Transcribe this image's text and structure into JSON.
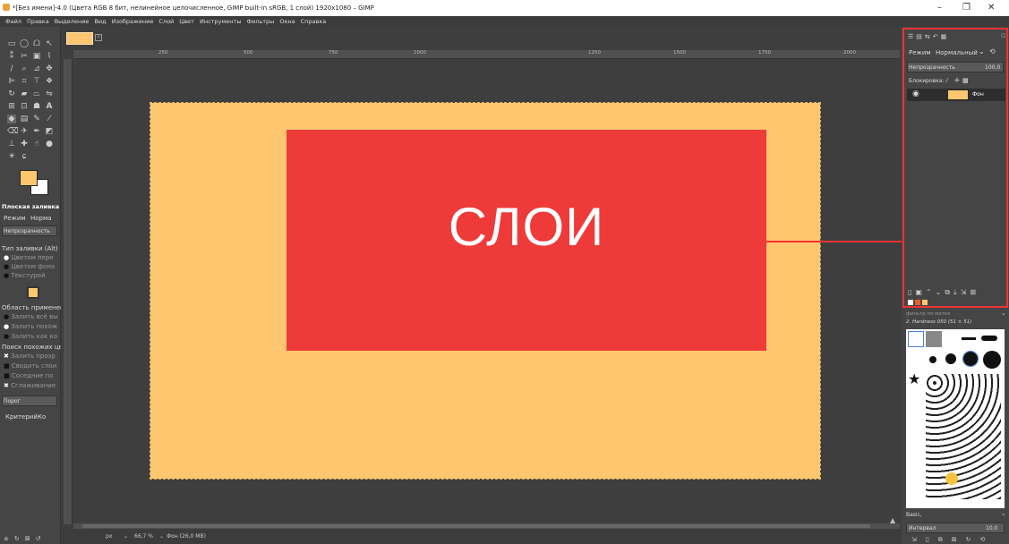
{
  "window": {
    "title": "*[Без имени]-4.0 (Цвета RGB 8 бит, нелинейное целочисленное, GIMP built-in sRGB, 1 слой) 1920x1080 – GIMP",
    "controls": [
      "–",
      "❐",
      "✕"
    ]
  },
  "menu": [
    "Файл",
    "Правка",
    "Выделение",
    "Вид",
    "Изображение",
    "Слой",
    "Цвет",
    "Инструменты",
    "Фильтры",
    "Окна",
    "Справка"
  ],
  "ruler": {
    "h_ticks": [
      "250",
      "500",
      "750",
      "1000",
      "1250",
      "1500",
      "1750",
      "2000"
    ]
  },
  "canvas": {
    "background_color": "#ffc670",
    "box_color": "#ef3a3a",
    "box_text": "СЛОИ"
  },
  "tool_options": {
    "title": "Плоская заливка",
    "mode_label": "Режим",
    "mode_value": "Норма",
    "opacity_label": "Непрозрачность",
    "fill_type_label": "Тип заливки (Alt)",
    "fill_options": [
      "Цветом пере",
      "Цветом фона",
      "Текстурой"
    ],
    "area_label": "Область применени",
    "area_options": [
      "Залить всё вы",
      "Залить похож",
      "Залить как ко"
    ],
    "similar_label": "Поиск похожих цве",
    "checks": [
      "Залить прозр",
      "Сводить слои",
      "Соседние по",
      "Сглаживание"
    ],
    "threshold_label": "Порог",
    "criterion_label": "Критерий",
    "criterion_value": "Ко"
  },
  "status": {
    "unit": "px",
    "zoom": "66,7 %",
    "info": "Фон (26,0 MB)"
  },
  "layers_panel": {
    "mode_label": "Режим",
    "mode_value": "Нормальный",
    "opacity_label": "Непрозрачность",
    "opacity_value": "100,0",
    "lock_label": "Блокировка:",
    "layer_name": "Фон"
  },
  "brushes_panel": {
    "filter_placeholder": "фильтр по метке",
    "brush_name": "2. Hardness 050 (51 × 51)",
    "preset": "Basic,",
    "spacing_label": "Интервал",
    "spacing_value": "10,0"
  },
  "colors": {
    "accent": "#ef3a3a",
    "canvas_bg": "#ffc670",
    "annotation": "#e33333"
  }
}
